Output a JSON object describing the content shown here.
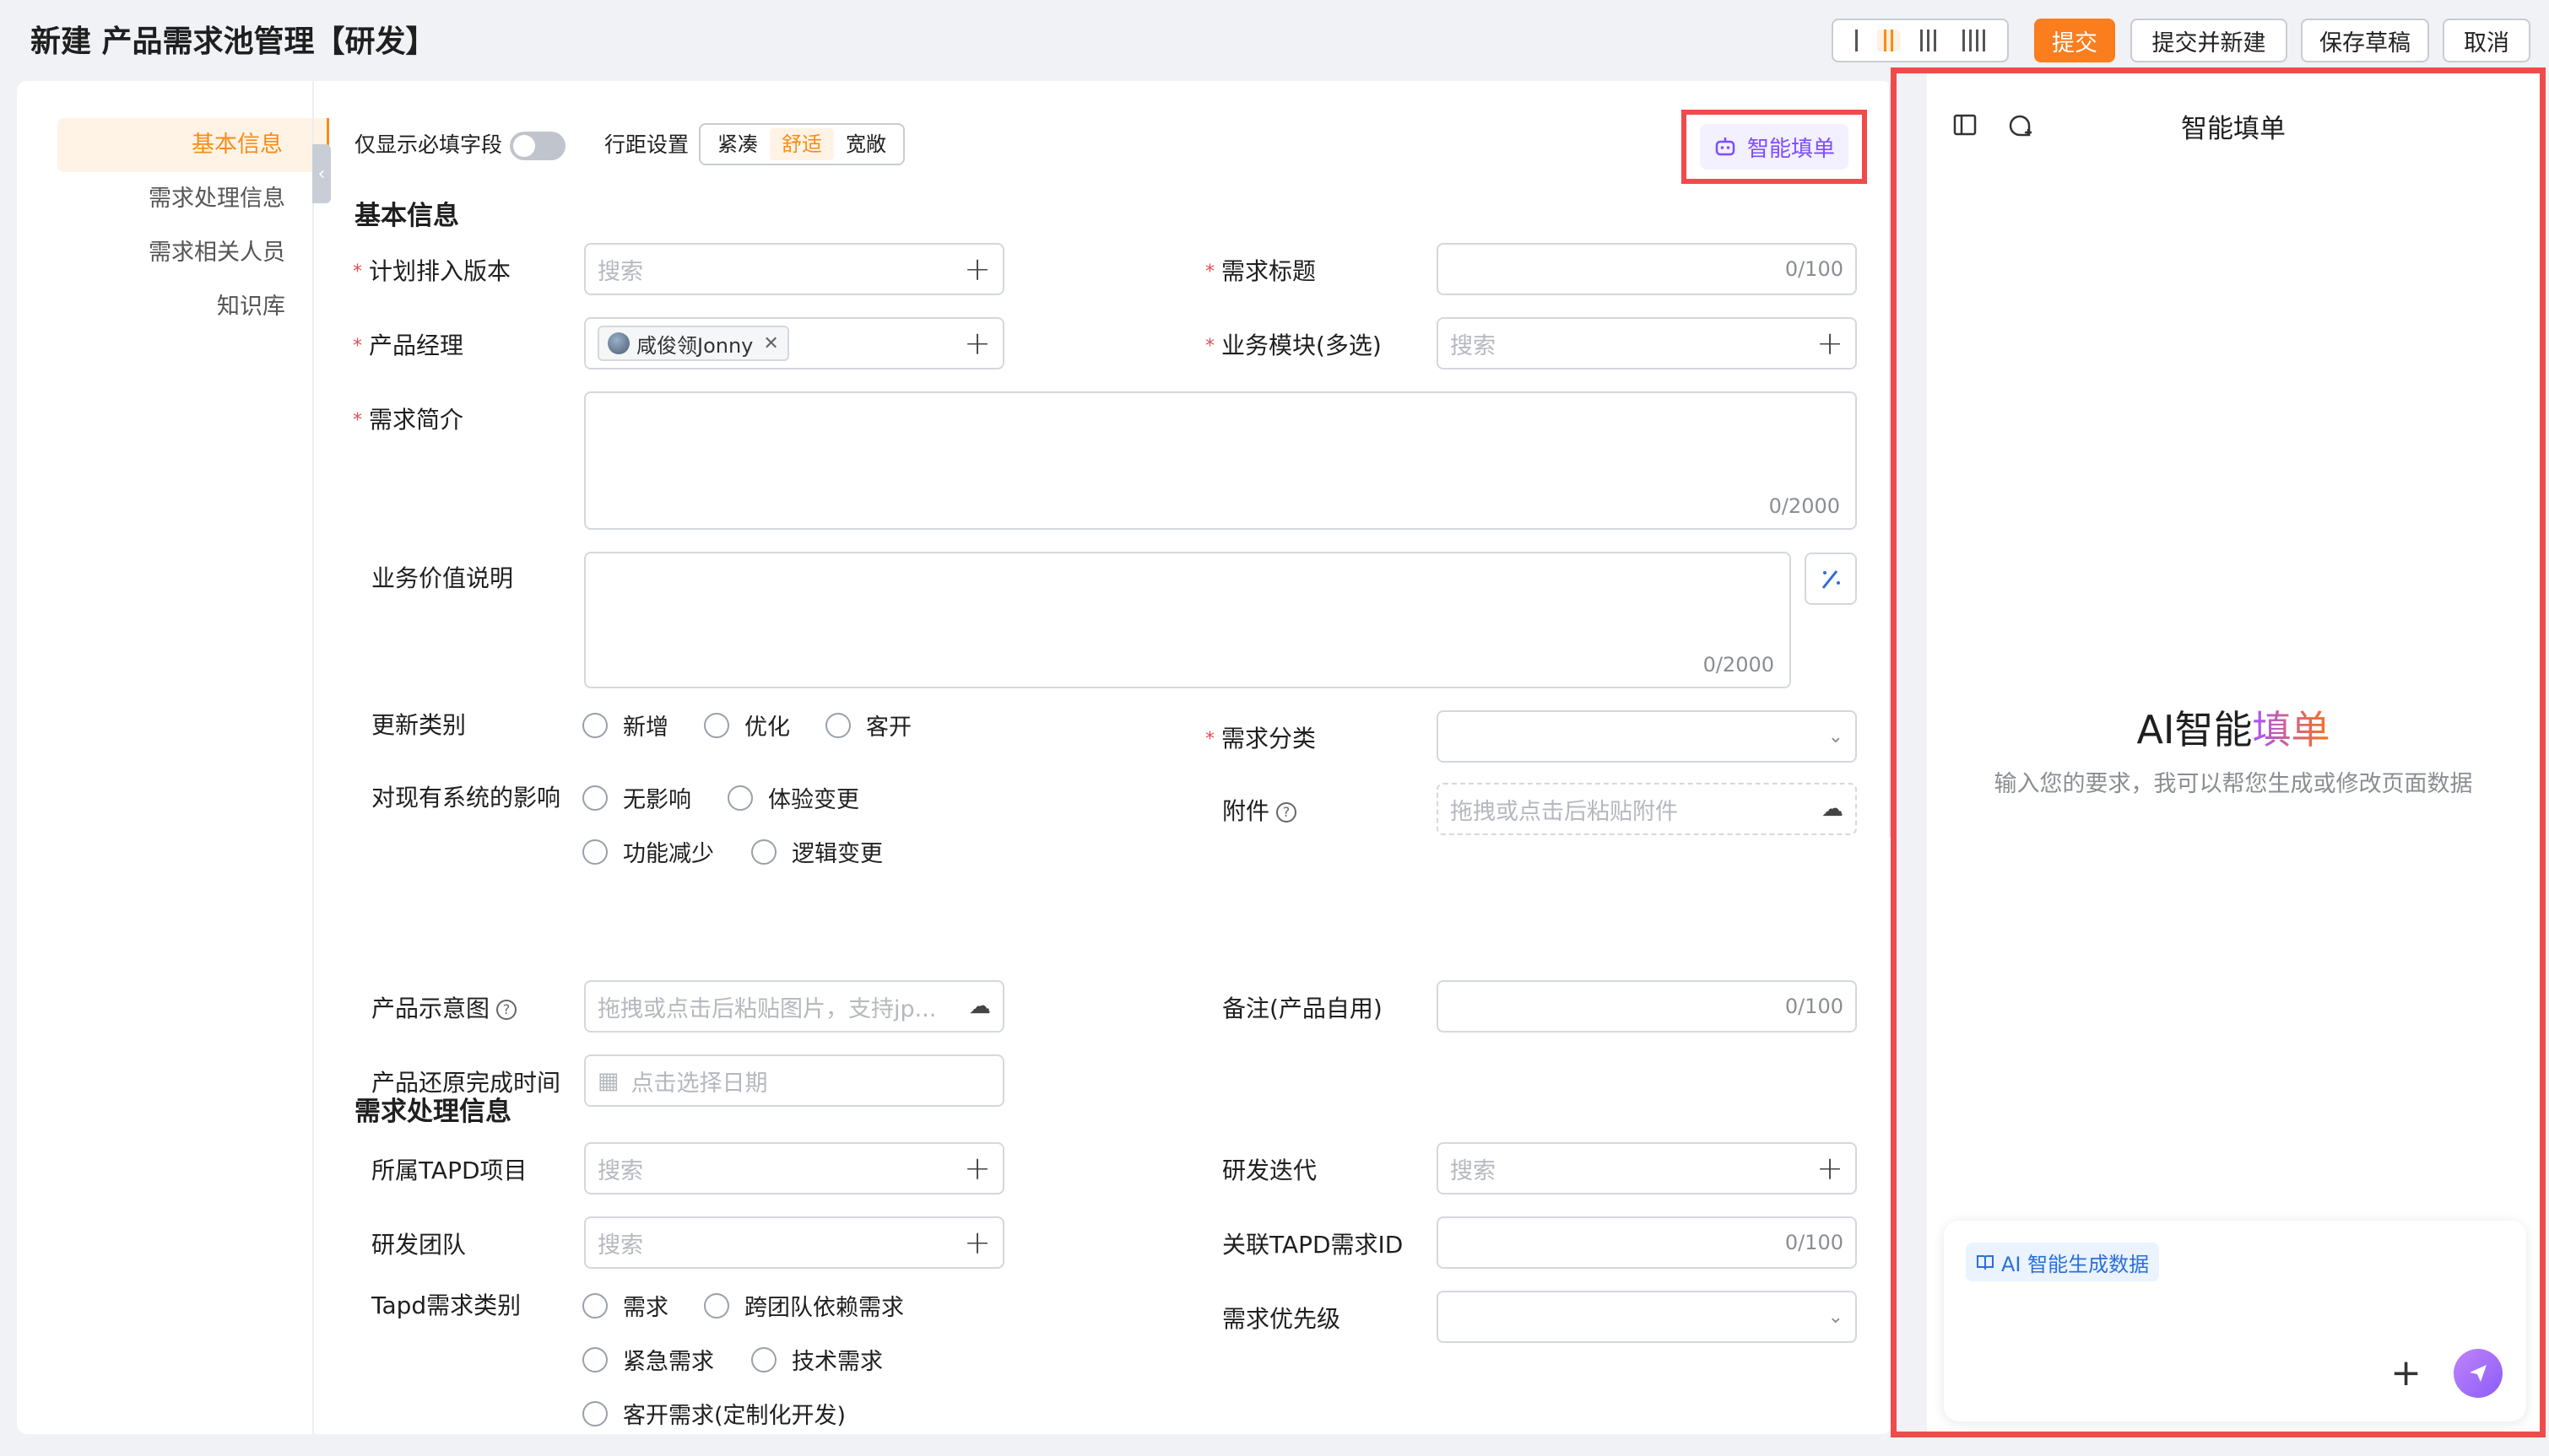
{
  "header": {
    "title": "新建 产品需求池管理【研发】",
    "actions": {
      "submit": "提交",
      "submit_and_new": "提交并新建",
      "save_draft": "保存草稿",
      "cancel": "取消"
    },
    "density_icons": [
      "one-column-icon",
      "two-column-icon",
      "three-column-icon",
      "four-column-icon"
    ]
  },
  "anchors": [
    "基本信息",
    "需求处理信息",
    "需求相关人员",
    "知识库"
  ],
  "toolbar": {
    "required_only_label": "仅显示必填字段",
    "spacing_label": "行距设置",
    "spacing_options": [
      "紧凑",
      "舒适",
      "宽敞"
    ],
    "spacing_selected": "舒适",
    "ai_fill_button": "智能填单"
  },
  "basic": {
    "section_title": "基本信息",
    "plan_version": {
      "label": "计划排入版本",
      "placeholder": "搜索"
    },
    "req_title": {
      "label": "需求标题",
      "counter": "0/100"
    },
    "product_manager": {
      "label": "产品经理",
      "tag": "咸俊领Jonny"
    },
    "business_module": {
      "label": "业务模块(多选)",
      "placeholder": "搜索"
    },
    "summary": {
      "label": "需求简介",
      "counter": "0/2000"
    },
    "business_value": {
      "label": "业务价值说明",
      "counter": "0/2000"
    },
    "update_type": {
      "label": "更新类别",
      "options": [
        "新增",
        "优化",
        "客开"
      ]
    },
    "req_category": {
      "label": "需求分类"
    },
    "impact": {
      "label": "对现有系统的影响",
      "options": [
        "无影响",
        "体验变更",
        "功能减少",
        "逻辑变更"
      ]
    },
    "attachment": {
      "label": "附件",
      "placeholder": "拖拽或点击后粘贴附件"
    },
    "diagram": {
      "label": "产品示意图",
      "placeholder": "拖拽或点击后粘贴图片，支持jp..."
    },
    "remark": {
      "label": "备注(产品自用)",
      "counter": "0/100"
    },
    "restore_time": {
      "label": "产品还原完成时间",
      "placeholder": "点击选择日期"
    }
  },
  "process": {
    "section_title": "需求处理信息",
    "tapd_project": {
      "label": "所属TAPD项目",
      "placeholder": "搜索"
    },
    "iteration": {
      "label": "研发迭代",
      "placeholder": "搜索"
    },
    "team": {
      "label": "研发团队",
      "placeholder": "搜索"
    },
    "tapd_id": {
      "label": "关联TAPD需求ID",
      "counter": "0/100"
    },
    "tapd_type": {
      "label": "Tapd需求类别",
      "options": [
        "需求",
        "跨团队依赖需求",
        "紧急需求",
        "技术需求",
        "客开需求(定制化开发)"
      ]
    },
    "priority": {
      "label": "需求优先级"
    }
  },
  "ai_panel": {
    "title": "智能填单",
    "hero_prefix": "AI智能",
    "hero_highlight": "填单",
    "subtitle": "输入您的要求，我可以帮您生成或修改页面数据",
    "chip": "AI 智能生成数据"
  }
}
